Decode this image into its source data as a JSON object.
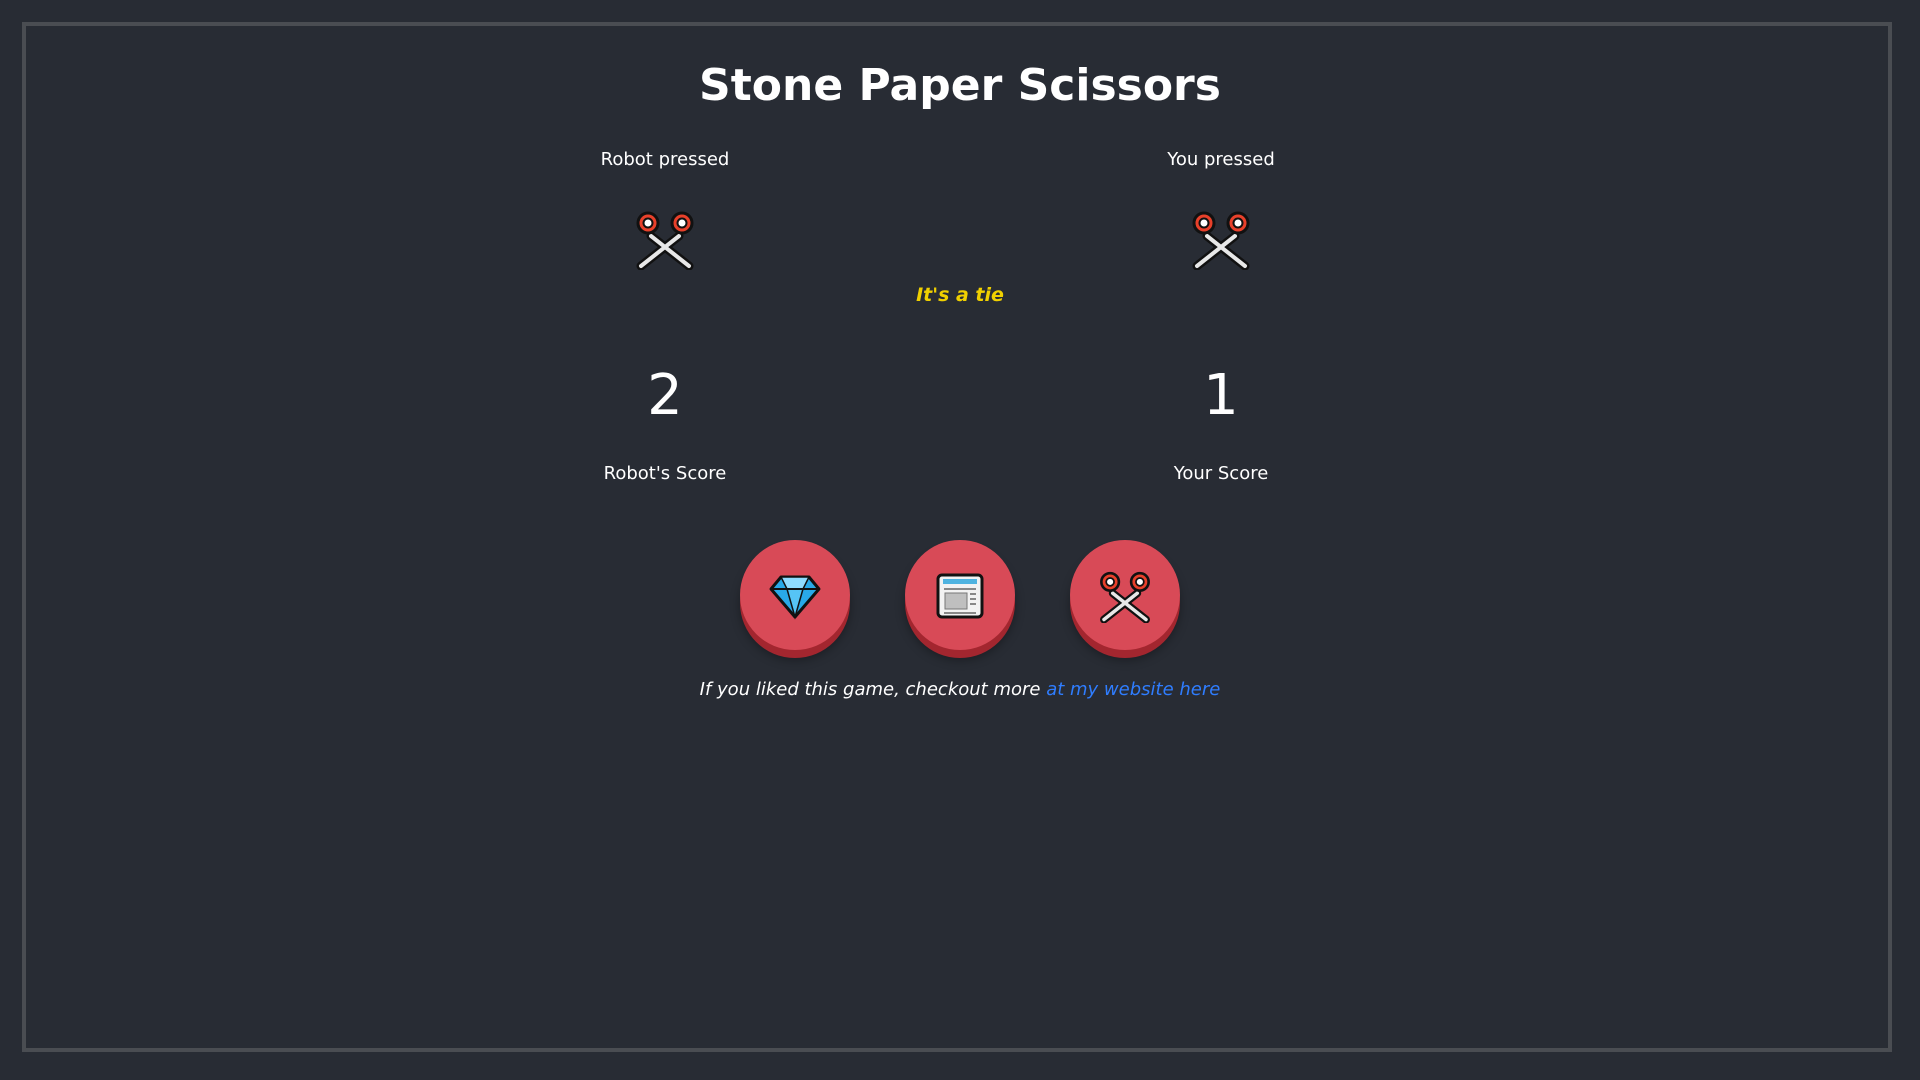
{
  "title": "Stone Paper Scissors",
  "robot": {
    "pressed_label": "Robot pressed",
    "pressed_icon": "scissors-icon",
    "score": "2",
    "score_label": "Robot's Score"
  },
  "you": {
    "pressed_label": "You pressed",
    "pressed_icon": "scissors-icon",
    "score": "1",
    "score_label": "Your Score"
  },
  "result": "It's a tie",
  "buttons": [
    {
      "name": "stone",
      "icon": "gem-stone-icon"
    },
    {
      "name": "paper",
      "icon": "newspaper-icon"
    },
    {
      "name": "scissors",
      "icon": "scissors-icon"
    }
  ],
  "footer": {
    "text": "If you liked this game, checkout more ",
    "link_text": "at my website here"
  },
  "colors": {
    "background": "#282c34",
    "button": "#d84a57",
    "result": "#f0d000",
    "link": "#2f7dff"
  }
}
